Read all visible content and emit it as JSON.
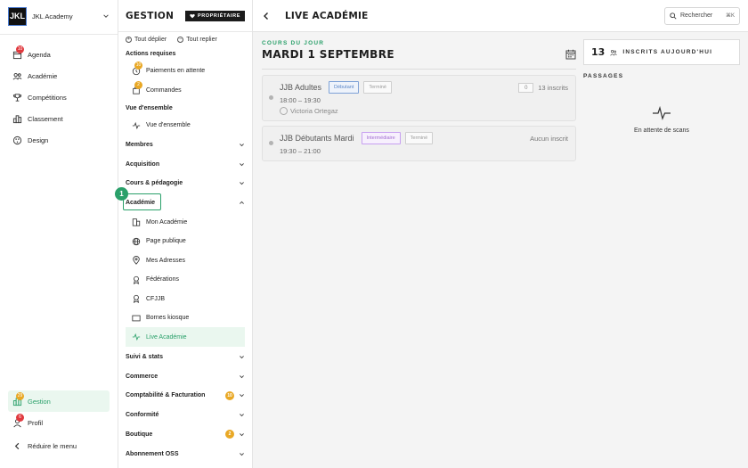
{
  "brand": {
    "logo_text": "JKL",
    "name": "JKL Academy"
  },
  "nav": {
    "items": [
      {
        "label": "Agenda",
        "icon": "calendar-icon",
        "badge": "10"
      },
      {
        "label": "Académie",
        "icon": "academy-icon"
      },
      {
        "label": "Compétitions",
        "icon": "trophy-icon"
      },
      {
        "label": "Classement",
        "icon": "ranking-icon"
      },
      {
        "label": "Design",
        "icon": "palette-icon"
      }
    ],
    "bottom": [
      {
        "label": "Gestion",
        "icon": "gestion-icon",
        "badge": "29"
      },
      {
        "label": "Profil",
        "icon": "user-icon",
        "badge": "6"
      },
      {
        "label": "Réduire le menu",
        "icon": "chevron-left-icon"
      }
    ]
  },
  "gestion": {
    "title": "GESTION",
    "owner_badge": "PROPRIÉTAIRE",
    "expand_all": "Tout déplier",
    "collapse_all": "Tout replier",
    "sections": [
      {
        "heading": "Actions requises",
        "rows": [
          {
            "label": "Paiements en attente",
            "badge": "10"
          },
          {
            "label": "Commandes",
            "badge": "2"
          }
        ]
      },
      {
        "heading": "Vue d'ensemble",
        "rows": [
          {
            "label": "Vue d'ensemble"
          }
        ]
      }
    ],
    "groups": [
      {
        "label": "Membres"
      },
      {
        "label": "Acquisition"
      },
      {
        "label": "Cours & pédagogie"
      },
      {
        "label": "Académie",
        "step": "1"
      }
    ],
    "academie_rows": [
      {
        "label": "Mon Académie"
      },
      {
        "label": "Page publique"
      },
      {
        "label": "Mes Adresses"
      },
      {
        "label": "Fédérations"
      },
      {
        "label": "CFJJB"
      },
      {
        "label": "Bornes kiosque"
      },
      {
        "label": "Live Académie"
      }
    ],
    "groups_after": [
      {
        "label": "Suivi & stats"
      },
      {
        "label": "Commerce"
      },
      {
        "label": "Comptabilité & Facturation",
        "count": "10"
      },
      {
        "label": "Conformité"
      },
      {
        "label": "Boutique",
        "count": "2"
      },
      {
        "label": "Abonnement OSS"
      }
    ]
  },
  "main": {
    "title": "LIVE ACADÉMIE",
    "search_label": "Rechercher",
    "search_kbd": "⌘K",
    "eyebrow": "COURS DU JOUR",
    "date": "MARDI 1 SEPTEMBRE",
    "courses": [
      {
        "name": "JJB Adultes",
        "level": "Débutant",
        "status": "Terminé",
        "time": "18:00 – 19:30",
        "coach": "Victoria Ortegaz",
        "count": "0",
        "enrolled": "13 inscrits"
      },
      {
        "name": "JJB Débutants Mardi",
        "level": "Intermédiaire",
        "status": "Terminé",
        "time": "19:30 – 21:00",
        "enrolled": "Aucun inscrit"
      }
    ],
    "today_count": "13",
    "today_label": "INSCRITS AUJOURD'HUI",
    "passages_label": "PASSAGES",
    "waiting": "En attente de scans"
  },
  "colors": {
    "accent": "#2aa06a",
    "badge_red": "#e0393e",
    "badge_gold": "#e9a825"
  }
}
